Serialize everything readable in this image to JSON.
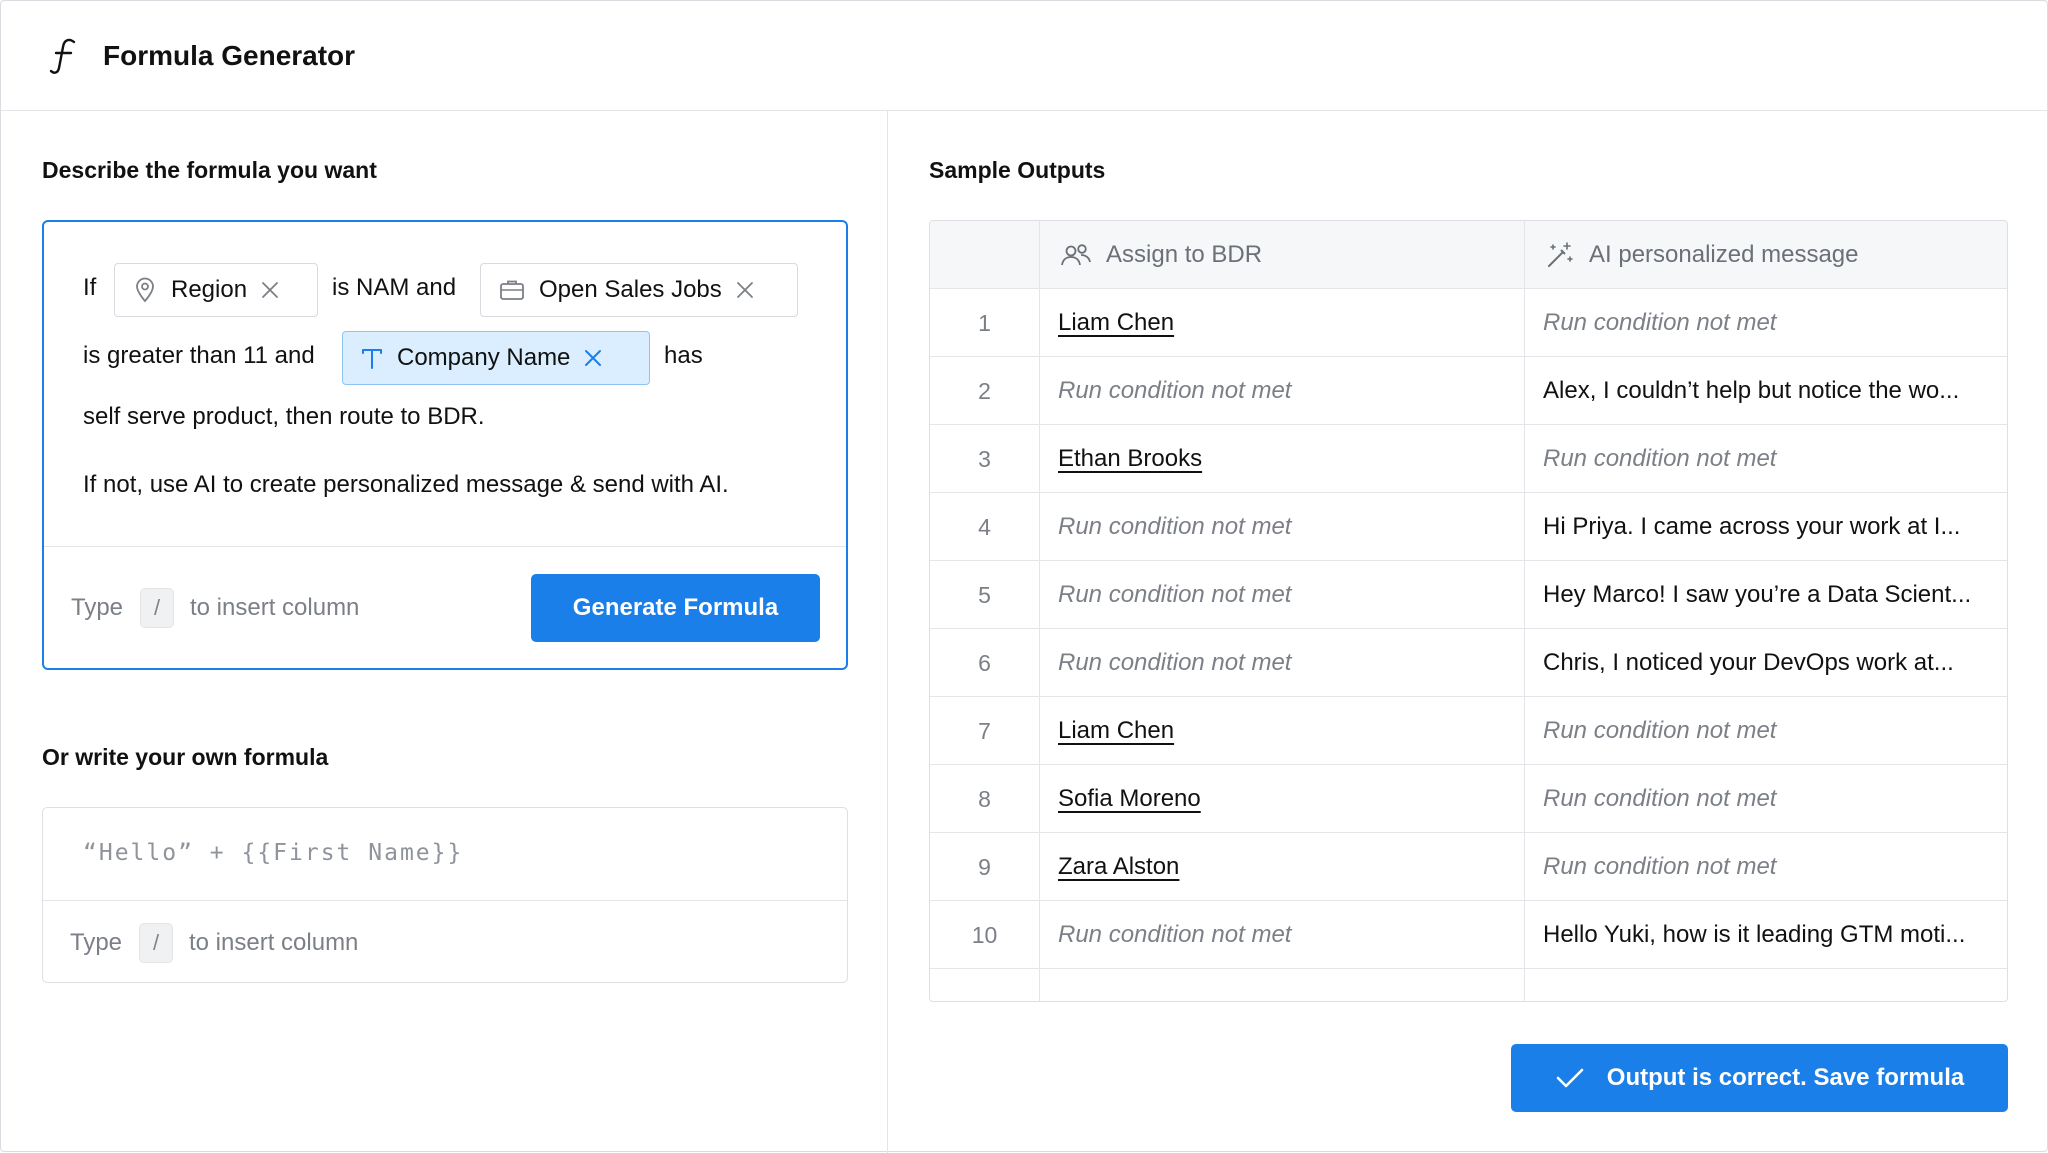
{
  "app": {
    "title": "Formula Generator",
    "icon": "function-icon"
  },
  "describe": {
    "label": "Describe the formula you want",
    "text": {
      "if": "If",
      "is_nam_and": "is NAM and",
      "greater_than": "is greater than 11 and",
      "has": "has",
      "line3": "self serve product, then route to BDR.",
      "line4": "If not, use AI to create personalized message & send with AI."
    },
    "chips": {
      "region": {
        "label": "Region",
        "icon": "map-pin-icon"
      },
      "open_sales_jobs": {
        "label": "Open Sales Jobs",
        "icon": "briefcase-icon"
      },
      "company_name": {
        "label": "Company Name",
        "icon": "text-type-icon"
      }
    },
    "hint": {
      "before": "Type",
      "key": "/",
      "after": "to insert column"
    },
    "generate_label": "Generate Formula"
  },
  "own_formula": {
    "label": "Or write your own formula",
    "placeholder": "“Hello” + {{First Name}}",
    "hint": {
      "before": "Type",
      "key": "/",
      "after": "to insert column"
    }
  },
  "sample_outputs": {
    "label": "Sample Outputs",
    "columns": [
      {
        "label": "Assign to BDR",
        "icon": "users-icon"
      },
      {
        "label": "AI personalized message",
        "icon": "magic-wand-icon"
      }
    ],
    "rows": [
      {
        "num": "1",
        "bdr": "Liam Chen",
        "message": "Run condition not met"
      },
      {
        "num": "2",
        "bdr": "Run condition not met",
        "message": "Alex, I couldn’t help but notice the wo..."
      },
      {
        "num": "3",
        "bdr": "Ethan Brooks",
        "message": "Run condition not met"
      },
      {
        "num": "4",
        "bdr": "Run condition not met",
        "message": "Hi Priya. I came across your work at I..."
      },
      {
        "num": "5",
        "bdr": "Run condition not met",
        "message": "Hey Marco! I saw you’re a Data Scient..."
      },
      {
        "num": "6",
        "bdr": "Run condition not met",
        "message": "Chris, I noticed your DevOps work at..."
      },
      {
        "num": "7",
        "bdr": "Liam Chen",
        "message": "Run condition not met"
      },
      {
        "num": "8",
        "bdr": "Sofia Moreno",
        "message": "Run condition not met"
      },
      {
        "num": "9",
        "bdr": "Zara Alston",
        "message": "Run condition not met"
      },
      {
        "num": "10",
        "bdr": "Run condition not met",
        "message": "Hello Yuki, how is it leading GTM moti..."
      }
    ],
    "save_label": "Output is correct. Save formula"
  },
  "colors": {
    "accent": "#1a7fe8",
    "chip_selected_bg": "#dbeeff",
    "muted_text": "#7b7f86"
  }
}
